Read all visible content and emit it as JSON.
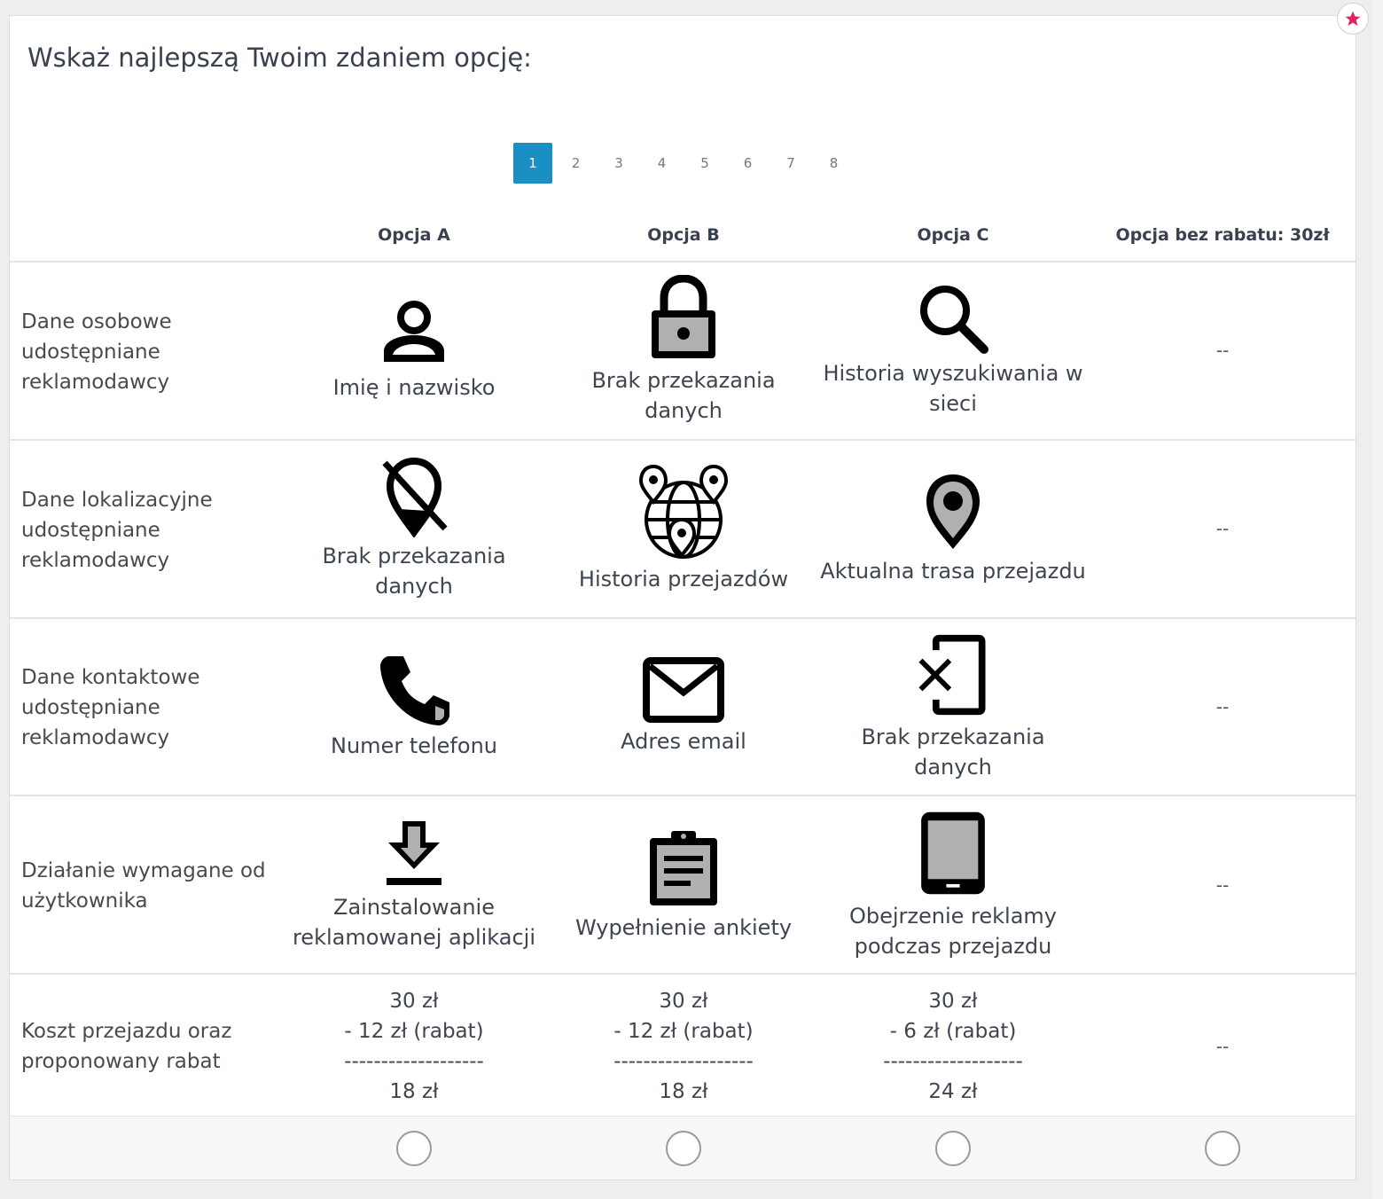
{
  "question": "Wskaż najlepszą Twoim zdaniem opcję:",
  "pagination": {
    "pages": [
      "1",
      "2",
      "3",
      "4",
      "5",
      "6",
      "7",
      "8"
    ],
    "active": "1"
  },
  "columns": [
    "Opcja A",
    "Opcja B",
    "Opcja C",
    "Opcja bez rabatu: 30zł"
  ],
  "rows": [
    {
      "label": "Dane osobowe udostępniane reklamodawcy",
      "cells": [
        {
          "icon": "person-icon",
          "text": "Imię i nazwisko"
        },
        {
          "icon": "lock-icon",
          "text": "Brak przekazania danych"
        },
        {
          "icon": "search-icon",
          "text": "Historia wyszukiwania w sieci"
        },
        {
          "text": "--"
        }
      ]
    },
    {
      "label": "Dane lokalizacyjne udostępniane reklamodawcy",
      "cells": [
        {
          "icon": "location-off-icon",
          "text": "Brak przekazania danych"
        },
        {
          "icon": "globe-pins-icon",
          "text": "Historia przejazdów"
        },
        {
          "icon": "map-pin-icon",
          "text": "Aktualna trasa przejazdu"
        },
        {
          "text": "--"
        }
      ]
    },
    {
      "label": "Dane kontaktowe udostępniane reklamodawcy",
      "cells": [
        {
          "icon": "phone-icon",
          "text": "Numer telefonu"
        },
        {
          "icon": "envelope-icon",
          "text": "Adres email"
        },
        {
          "icon": "phone-off-icon",
          "text": "Brak przekazania danych"
        },
        {
          "text": "--"
        }
      ]
    },
    {
      "label": "Działanie wymagane od użytkownika",
      "cells": [
        {
          "icon": "download-icon",
          "text": "Zainstalowanie reklamowanej aplikacji"
        },
        {
          "icon": "clipboard-icon",
          "text": "Wypełnienie ankiety"
        },
        {
          "icon": "tablet-icon",
          "text": "Obejrzenie reklamy podczas przejazdu"
        },
        {
          "text": "--"
        }
      ]
    },
    {
      "label": "Koszt przejazdu oraz proponowany rabat",
      "cells": [
        {
          "lines": [
            "30 zł",
            "- 12 zł (rabat)",
            "-------------------",
            "18 zł"
          ]
        },
        {
          "lines": [
            "30 zł",
            "- 12 zł (rabat)",
            "-------------------",
            "18 zł"
          ]
        },
        {
          "lines": [
            "30 zł",
            "- 6 zł (rabat)",
            "-------------------",
            "24 zł"
          ]
        },
        {
          "text": "--"
        }
      ]
    }
  ],
  "colors": {
    "accent": "#1a8fc3",
    "star": "#e0245e",
    "icon": "#000000",
    "icon_fill": "#b0b0b0"
  }
}
